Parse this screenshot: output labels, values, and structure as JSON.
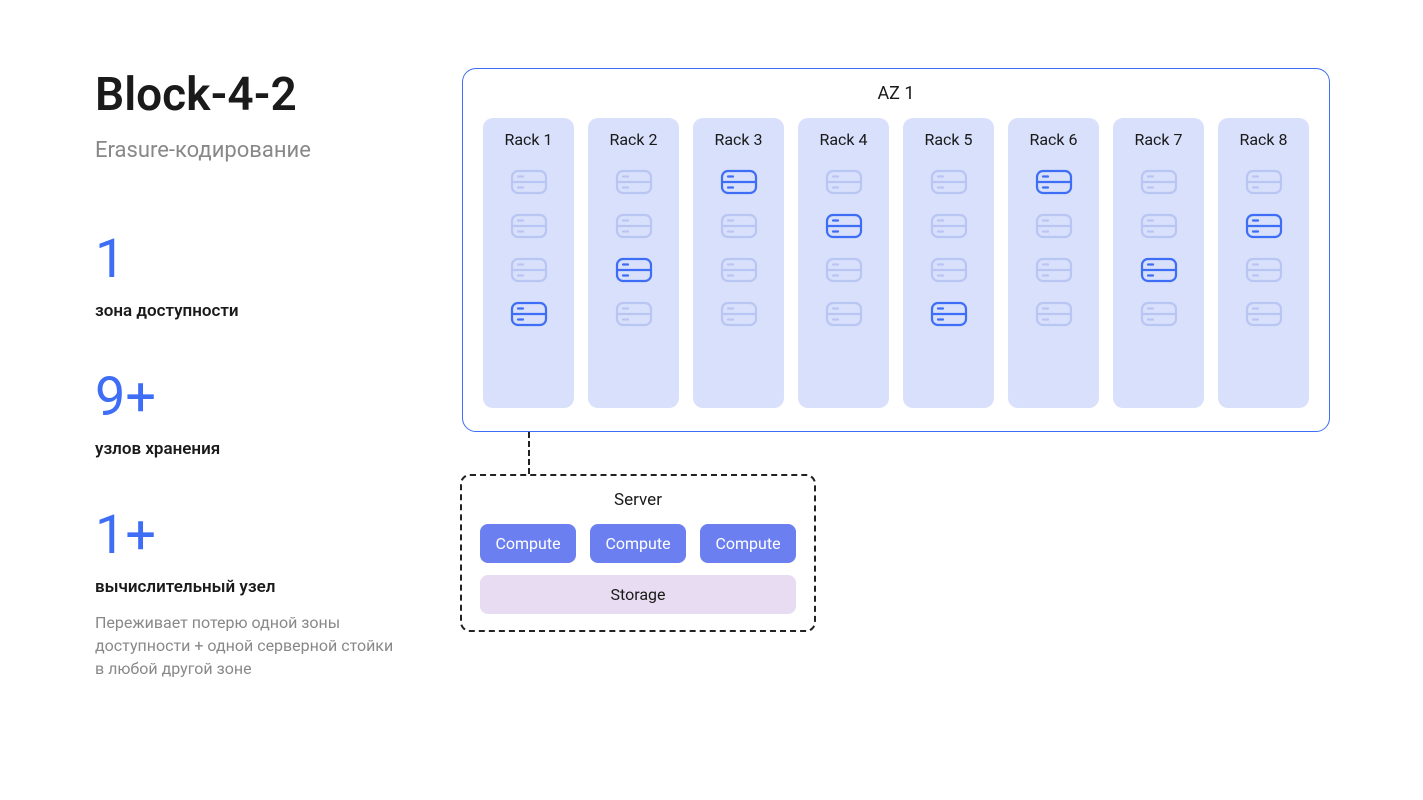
{
  "title": "Block-4-2",
  "subtitle": "Erasure-кодирование",
  "stats": [
    {
      "num": "1",
      "label": "зона доступности"
    },
    {
      "num": "9+",
      "label": "узлов хранения"
    },
    {
      "num": "1+",
      "label": "вычислительный узел",
      "desc": "Переживает потерю одной зоны доступности + одной серверной стойки в любой другой зоне"
    }
  ],
  "az": {
    "title": "AZ 1",
    "racks": [
      {
        "label": "Rack 1",
        "disks": [
          "faded",
          "faded",
          "faded",
          "active"
        ]
      },
      {
        "label": "Rack 2",
        "disks": [
          "faded",
          "faded",
          "active",
          "faded"
        ]
      },
      {
        "label": "Rack 3",
        "disks": [
          "active",
          "faded",
          "faded",
          "faded"
        ]
      },
      {
        "label": "Rack 4",
        "disks": [
          "faded",
          "active",
          "faded",
          "faded"
        ]
      },
      {
        "label": "Rack 5",
        "disks": [
          "faded",
          "faded",
          "faded",
          "active"
        ]
      },
      {
        "label": "Rack 6",
        "disks": [
          "active",
          "faded",
          "faded",
          "faded"
        ]
      },
      {
        "label": "Rack 7",
        "disks": [
          "faded",
          "faded",
          "active",
          "faded"
        ]
      },
      {
        "label": "Rack 8",
        "disks": [
          "faded",
          "active",
          "faded",
          "faded"
        ]
      }
    ]
  },
  "server": {
    "title": "Server",
    "computes": [
      "Compute",
      "Compute",
      "Compute"
    ],
    "storage": "Storage"
  }
}
